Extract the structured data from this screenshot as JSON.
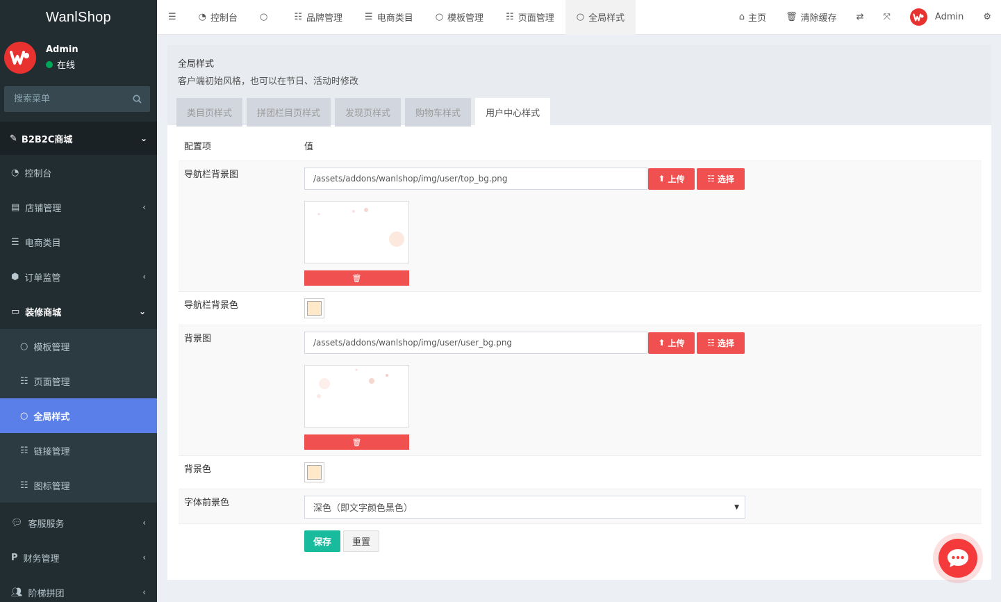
{
  "app": {
    "title": "WanlShop"
  },
  "user": {
    "name": "Admin",
    "status": "在线"
  },
  "sidebar": {
    "search_placeholder": "搜索菜单",
    "header": "B2B2C商城",
    "items": [
      {
        "label": "控制台",
        "icon": "dashboard-icon"
      },
      {
        "label": "店铺管理",
        "icon": "shop-icon"
      },
      {
        "label": "电商类目",
        "icon": "list-icon"
      },
      {
        "label": "订单监管",
        "icon": "cube-icon"
      },
      {
        "label": "装修商城",
        "icon": "monitor-icon"
      }
    ],
    "sub_items": [
      {
        "label": "模板管理",
        "icon": "circle-icon"
      },
      {
        "label": "页面管理",
        "icon": "list-icon"
      },
      {
        "label": "全局样式",
        "icon": "circle-icon"
      },
      {
        "label": "链接管理",
        "icon": "list-icon"
      },
      {
        "label": "图标管理",
        "icon": "list-icon"
      }
    ],
    "bottom_items": [
      {
        "label": "客服服务",
        "icon": "chat-icon"
      },
      {
        "label": "财务管理",
        "icon": "paypal-icon"
      },
      {
        "label": "阶梯拼团",
        "icon": "users-icon"
      }
    ]
  },
  "topbar": {
    "tabs": [
      {
        "label": "控制台"
      },
      {
        "label": ""
      },
      {
        "label": "品牌管理"
      },
      {
        "label": "电商类目"
      },
      {
        "label": "模板管理"
      },
      {
        "label": "页面管理"
      },
      {
        "label": "全局样式"
      }
    ],
    "home": "主页",
    "clear_cache": "清除缓存",
    "admin": "Admin"
  },
  "content": {
    "title": "全局样式",
    "description": "客户端初始风格，也可以在节日、活动时修改",
    "sub_tabs": [
      "类目页样式",
      "拼团栏目页样式",
      "发现页样式",
      "购物车样式",
      "用户中心样式"
    ],
    "table_headers": {
      "key": "配置项",
      "value": "值"
    },
    "rows": {
      "nav_bg_image": {
        "label": "导航栏背景图",
        "value": "/assets/addons/wanlshop/img/user/top_bg.png"
      },
      "nav_bg_color": {
        "label": "导航栏背景色",
        "color": "#ffe9c8"
      },
      "bg_image": {
        "label": "背景图",
        "value": "/assets/addons/wanlshop/img/user/user_bg.png"
      },
      "bg_color": {
        "label": "背景色",
        "color": "#ffe9c8"
      },
      "font_color": {
        "label": "字体前景色",
        "value": "深色（即文字颜色黑色）"
      }
    },
    "buttons": {
      "upload": "上传",
      "choose": "选择",
      "save": "保存",
      "reset": "重置"
    }
  },
  "colors": {
    "accent": "#f05050",
    "sidebar_bg": "#222d32",
    "active_item": "#5b7fe8",
    "save": "#18bc9c"
  }
}
